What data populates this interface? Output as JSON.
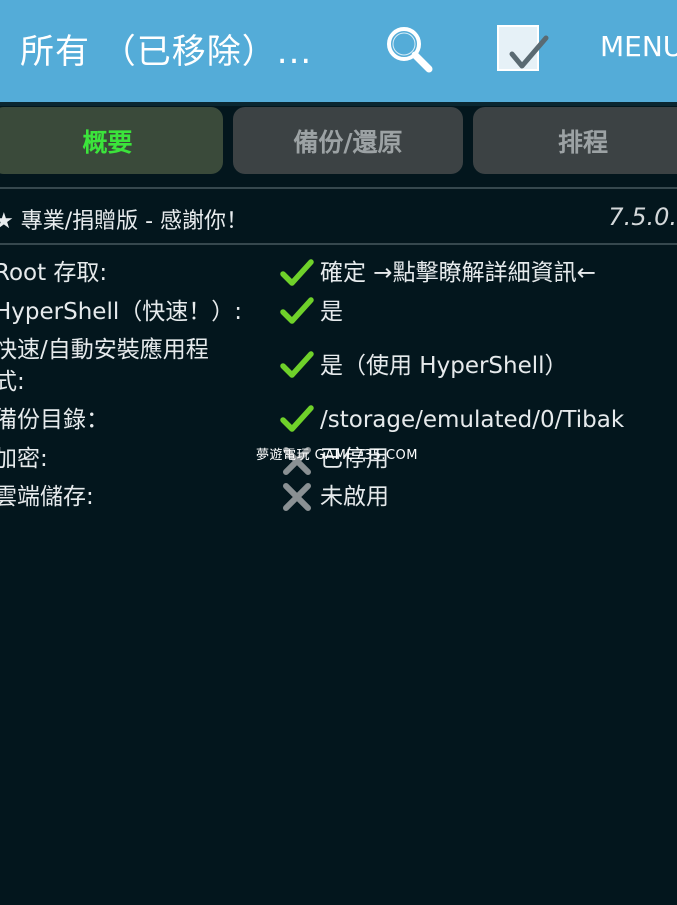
{
  "header": {
    "title": "所有 （已移除）...",
    "search_icon": "search-icon",
    "select_icon": "checklist-icon",
    "menu_label": "MENU",
    "background_color": "#54acd8"
  },
  "tabs": [
    {
      "label": "概要",
      "active": true
    },
    {
      "label": "備份/還原",
      "active": false
    },
    {
      "label": "排程",
      "active": false
    }
  ],
  "pro": {
    "label": "★ 專業/捐贈版 - 感謝你！",
    "version": "7.5.0."
  },
  "status_rows": [
    {
      "label": "Root 存取:",
      "icon": "check-icon",
      "value": "確定 →點擊瞭解詳細資訊←"
    },
    {
      "label": "HyperShell（快速！）:",
      "icon": "check-icon",
      "value": "是"
    },
    {
      "label_line1": "快速/自動安裝應用程",
      "label_line2": "式:",
      "icon": "check-icon",
      "value": "是（使用 HyperShell）"
    },
    {
      "label": "備份目錄：",
      "icon": "check-icon",
      "value": "/storage/emulated/0/Tibak"
    },
    {
      "label": "加密:",
      "icon": "cross-icon",
      "value": "已停用"
    },
    {
      "label": "雲端儲存:",
      "icon": "cross-icon",
      "value": "未啟用"
    }
  ],
  "watermark": "夢遊電玩 GAME735.COM",
  "colors": {
    "check": "#6fd12a",
    "cross": "#8a9093",
    "active_tab_text": "#3be43b"
  }
}
